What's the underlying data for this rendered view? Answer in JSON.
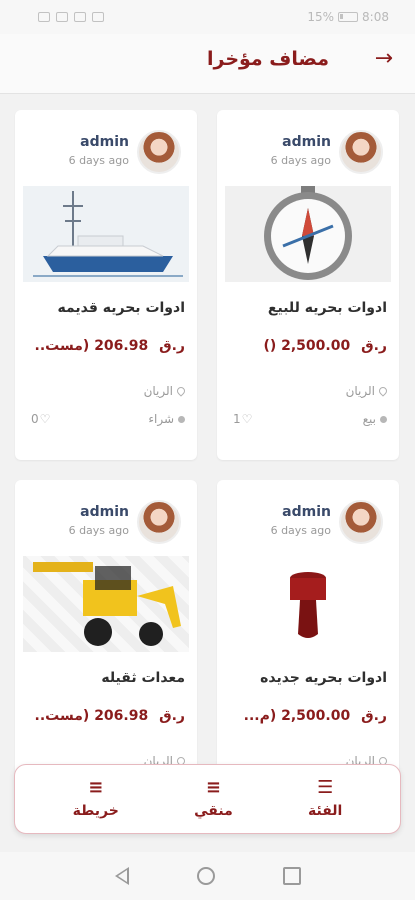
{
  "status": {
    "battery_text": "15%",
    "time": "8:08"
  },
  "appbar": {
    "title": "مضاف مؤخرا",
    "back_icon": "arrow-right-icon"
  },
  "cards": [
    {
      "owner": "admin",
      "posted": "6 days ago",
      "title": "ادوات بحريه للبيع",
      "price": "2,500.00",
      "currency": "ر.ق",
      "price_note": "()",
      "location": "الريان",
      "type": "بيع",
      "likes": "1",
      "thumb_kind": "compass"
    },
    {
      "owner": "admin",
      "posted": "6 days ago",
      "title": "ادوات بحريه قديمه",
      "price": "206.98",
      "currency": "ر.ق",
      "price_note": "(مست..",
      "location": "الريان",
      "type": "شراء",
      "likes": "0",
      "thumb_kind": "boat"
    },
    {
      "owner": "admin",
      "posted": "6 days ago",
      "title": "ادوات بحريه جديده",
      "price": "2,500.00",
      "currency": "ر.ق",
      "price_note": "(م...",
      "location": "الريان",
      "type": "",
      "likes": "",
      "thumb_kind": "fender"
    },
    {
      "owner": "admin",
      "posted": "6 days ago",
      "title": "معدات ثقيله",
      "price": "206.98",
      "currency": "ر.ق",
      "price_note": "(مست..",
      "location": "الريان",
      "type": "",
      "likes": "",
      "thumb_kind": "loader"
    }
  ],
  "bottom_bar": {
    "category_label": "الفئة",
    "filter_label": "منقي",
    "map_label": "خريطة"
  },
  "colors": {
    "accent": "#8a1c1c",
    "border_accent": "#e6b9bf"
  }
}
